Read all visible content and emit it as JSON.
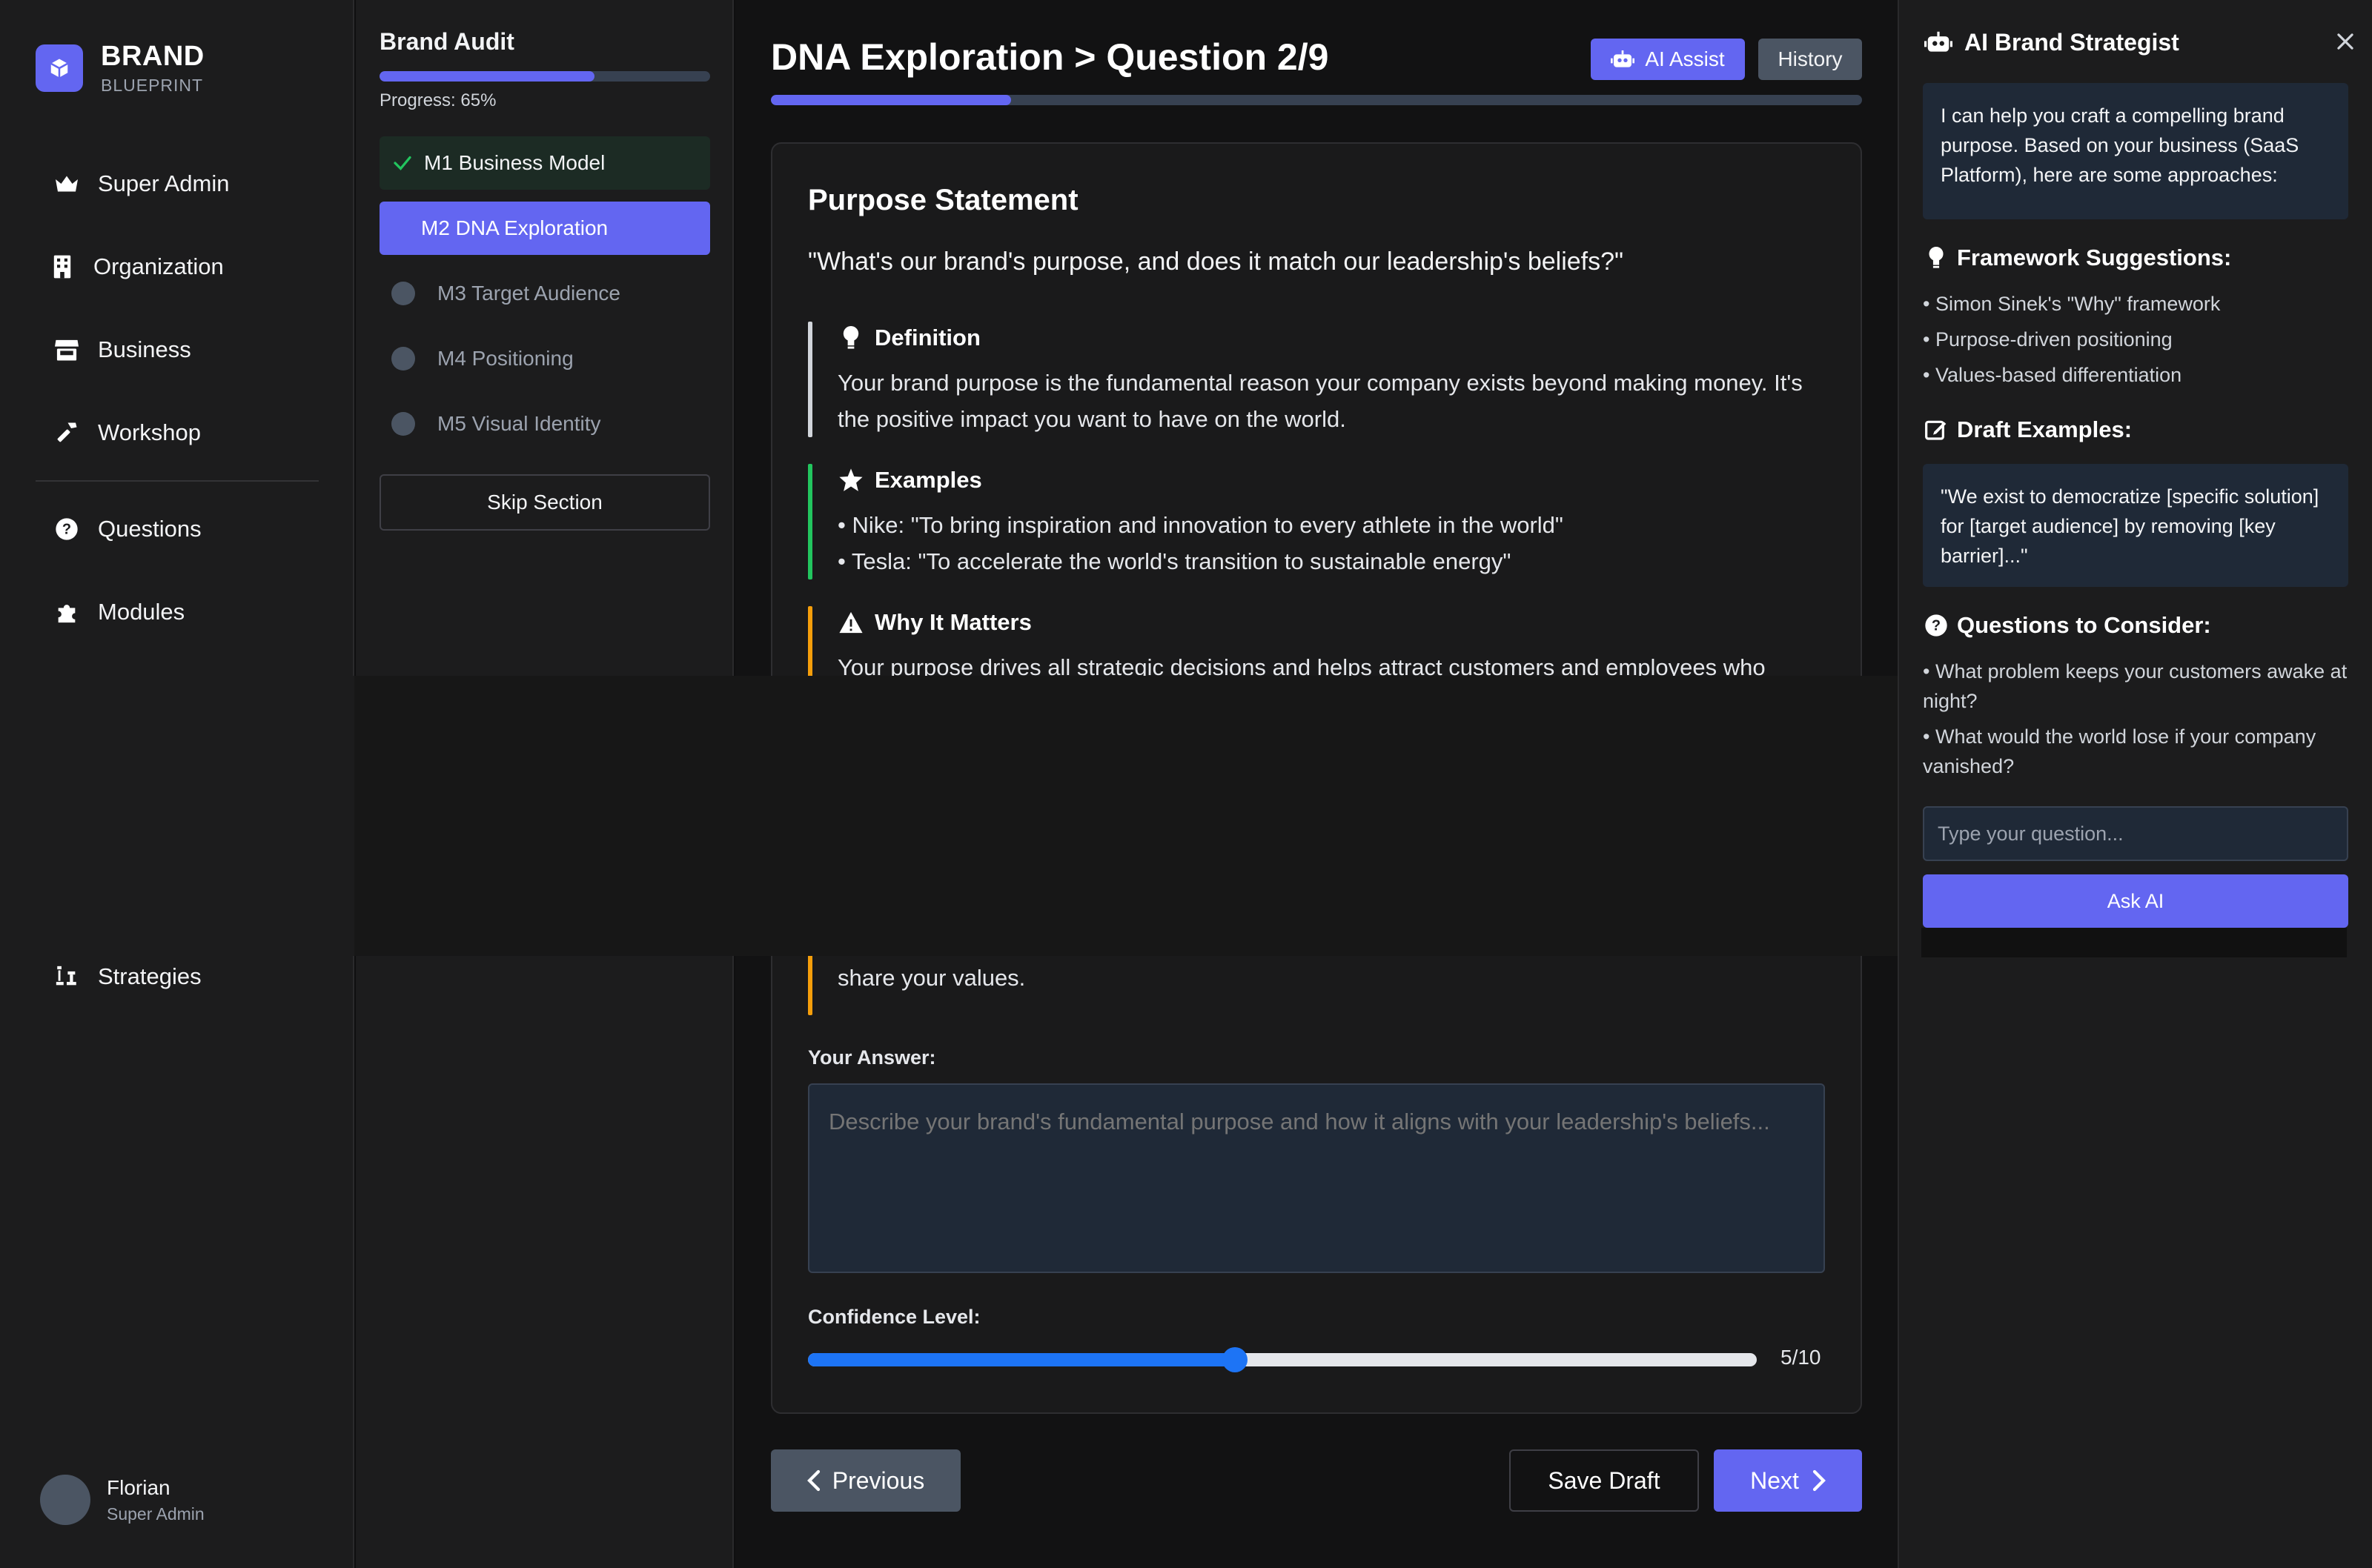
{
  "brand": {
    "name": "BRAND",
    "subtitle": "BLUEPRINT"
  },
  "nav": {
    "items": [
      {
        "label": "Super Admin",
        "icon": "crown-icon"
      },
      {
        "label": "Organization",
        "icon": "building-icon"
      },
      {
        "label": "Business",
        "icon": "store-icon"
      },
      {
        "label": "Workshop",
        "icon": "hammer-icon"
      },
      {
        "label": "Questions",
        "icon": "question-circle-icon"
      },
      {
        "label": "Modules",
        "icon": "puzzle-icon"
      },
      {
        "label": "Strategies",
        "icon": "chess-icon"
      }
    ]
  },
  "user": {
    "name": "Florian",
    "role": "Super Admin"
  },
  "audit": {
    "title": "Brand Audit",
    "progress_label": "Progress: 65%",
    "progress": 0.65,
    "modules": [
      {
        "label": "M1 Business Model",
        "state": "done"
      },
      {
        "label": "M2 DNA Exploration",
        "state": "active"
      },
      {
        "label": "M3 Target Audience",
        "state": "todo"
      },
      {
        "label": "M4 Positioning",
        "state": "todo"
      },
      {
        "label": "M5 Visual Identity",
        "state": "todo"
      }
    ],
    "skip_label": "Skip Section"
  },
  "main": {
    "title": "DNA Exploration > Question 2/9",
    "ai_assist_label": "AI Assist",
    "history_label": "History",
    "question_progress": 0.22,
    "card": {
      "title": "Purpose Statement",
      "question": "\"What's our brand's purpose, and does it match our leadership's beliefs?\"",
      "definition": {
        "heading": "Definition",
        "body": "Your brand purpose is the fundamental reason your company exists beyond making money. It's the positive impact you want to have on the world."
      },
      "examples": {
        "heading": "Examples",
        "items": [
          "• Nike: \"To bring inspiration and innovation to every athlete in the world\"",
          "• Tesla: \"To accelerate the world's transition to sustainable energy\""
        ]
      },
      "why": {
        "heading": "Why It Matters",
        "body_top": "Your purpose drives all strategic decisions and helps attract customers and employees who",
        "body_bottom": "share your values."
      },
      "answer_label": "Your Answer:",
      "answer_placeholder": "Describe your brand's fundamental purpose and how it aligns with your leadership's beliefs...",
      "confidence_label": "Confidence Level:",
      "confidence_value": 5,
      "confidence_max": 10,
      "confidence_text": "5/10"
    },
    "buttons": {
      "previous": "Previous",
      "save_draft": "Save Draft",
      "next": "Next"
    }
  },
  "ai_panel": {
    "title": "AI Brand Strategist",
    "intro": "I can help you craft a compelling brand purpose. Based on your business (SaaS Platform), here are some approaches:",
    "frameworks": {
      "heading": "Framework Suggestions:",
      "items": [
        "• Simon Sinek's \"Why\" framework",
        "• Purpose-driven positioning",
        "• Values-based differentiation"
      ]
    },
    "drafts": {
      "heading": "Draft Examples:",
      "text": "\"We exist to democratize [specific solution] for [target audience] by removing [key barrier]...\""
    },
    "consider": {
      "heading": "Questions to Consider:",
      "items": [
        "• What problem keeps your customers awake at night?",
        "• What would the world lose if your company vanished?"
      ]
    },
    "input_placeholder": "Type your question...",
    "ask_label": "Ask AI"
  },
  "colors": {
    "accent": "#6366f1",
    "success": "#22c55e",
    "warning": "#f59e0b",
    "slider": "#1d74f5"
  }
}
